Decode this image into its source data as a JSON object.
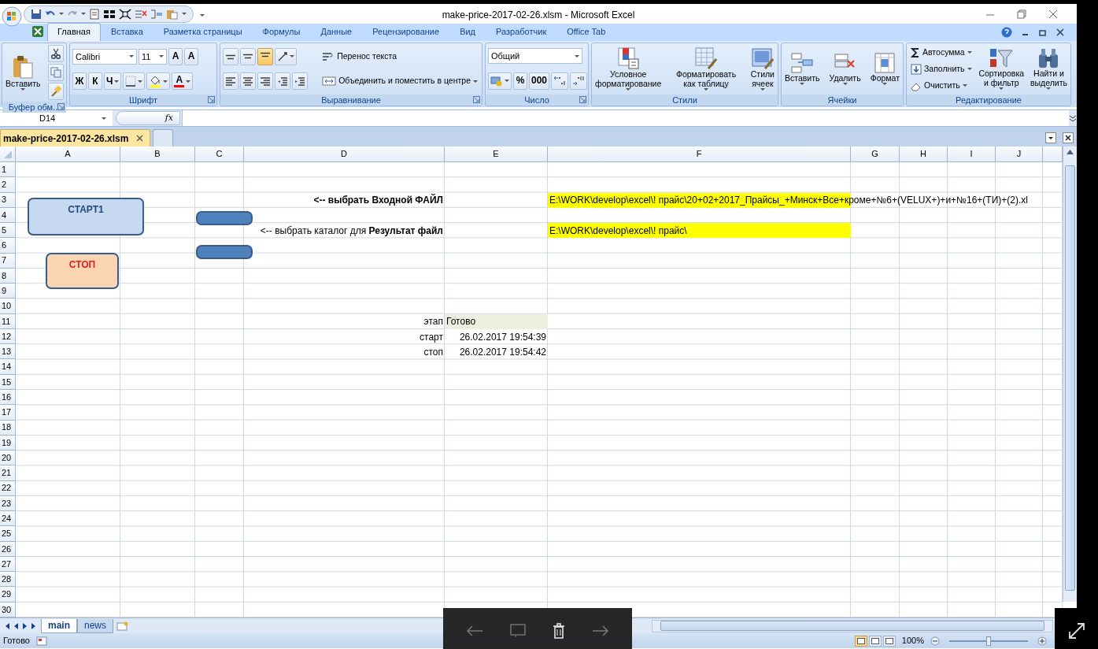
{
  "window": {
    "title": "make-price-2017-02-26.xlsm - Microsoft Excel"
  },
  "ribbon_tabs": [
    {
      "label": "Главная",
      "selected": true
    },
    {
      "label": "Вставка",
      "selected": false
    },
    {
      "label": "Разметка страницы",
      "selected": false
    },
    {
      "label": "Формулы",
      "selected": false
    },
    {
      "label": "Данные",
      "selected": false
    },
    {
      "label": "Рецензирование",
      "selected": false
    },
    {
      "label": "Вид",
      "selected": false
    },
    {
      "label": "Разработчик",
      "selected": false
    },
    {
      "label": "Office Tab",
      "selected": false
    }
  ],
  "ribbon_groups": [
    {
      "label": "Буфер обм...",
      "launcher": true,
      "columns": [
        [
          {
            "kind": "large",
            "label": "Вставить",
            "dropdown": true
          }
        ],
        [
          {
            "kind": "icon",
            "dropdown": false
          },
          {
            "kind": "icon",
            "dropdown": false
          },
          {
            "kind": "icon",
            "dropdown": false
          }
        ]
      ]
    },
    {
      "label": "Шрифт",
      "launcher": true,
      "columns": [
        [
          {
            "kind": "row",
            "items": [
              {
                "kind": "combo",
                "value": "Calibri",
                "dropdown": true
              },
              {
                "kind": "combo",
                "value": "11",
                "dropdown": true
              },
              {
                "kind": "letter",
                "label": "A",
                "dropdown": false
              },
              {
                "kind": "letter",
                "label": "A",
                "dropdown": false
              }
            ]
          },
          {
            "kind": "row",
            "items": [
              {
                "kind": "letter",
                "label": "Ж",
                "dropdown": false
              },
              {
                "kind": "letter",
                "label": "К",
                "dropdown": false
              },
              {
                "kind": "letter",
                "label": "Ч",
                "dropdown": true
              },
              {
                "kind": "icon",
                "dropdown": true
              },
              {
                "kind": "icon",
                "dropdown": true,
                "color": "#ffff00"
              },
              {
                "kind": "letter",
                "label": "A",
                "dropdown": true,
                "color": "#ff0000"
              }
            ]
          }
        ]
      ]
    },
    {
      "label": "Выравнивание",
      "launcher": true,
      "columns": [
        [
          {
            "kind": "row",
            "items": [
              {
                "kind": "icon",
                "on": false,
                "dropdown": false
              },
              {
                "kind": "icon",
                "on": false,
                "dropdown": false
              },
              {
                "kind": "icon",
                "on": true,
                "dropdown": false
              },
              {
                "kind": "icon",
                "on": false,
                "dropdown": true
              }
            ]
          },
          {
            "kind": "row",
            "items": [
              {
                "kind": "icon",
                "on": false,
                "dropdown": false
              },
              {
                "kind": "icon",
                "on": false,
                "dropdown": false
              },
              {
                "kind": "icon",
                "on": false,
                "dropdown": false
              },
              {
                "kind": "icon",
                "on": false,
                "dropdown": false
              },
              {
                "kind": "icon",
                "on": false,
                "dropdown": false
              }
            ]
          }
        ],
        [
          {
            "kind": "small",
            "label": "Перенос текста",
            "dropdown": false
          },
          {
            "kind": "small",
            "label": "Объединить и поместить в центре",
            "dropdown": true
          }
        ]
      ]
    },
    {
      "label": "Число",
      "launcher": true,
      "columns": [
        [
          {
            "kind": "combo",
            "value": "Общий",
            "dropdown": true
          },
          {
            "kind": "row",
            "items": [
              {
                "kind": "icon",
                "dropdown": true
              },
              {
                "kind": "letter",
                "label": "%",
                "dropdown": false
              },
              {
                "kind": "letter",
                "label": "000",
                "dropdown": false
              },
              {
                "kind": "icon",
                "dropdown": false
              },
              {
                "kind": "icon",
                "dropdown": false
              }
            ]
          }
        ]
      ]
    },
    {
      "label": "Стили",
      "launcher": false,
      "columns": [
        [
          {
            "kind": "large",
            "label": "Условное\nформатирование",
            "dropdown": true
          }
        ],
        [
          {
            "kind": "large",
            "label": "Форматировать\nкак таблицу",
            "dropdown": true
          }
        ],
        [
          {
            "kind": "large",
            "label": "Стили\nячеек",
            "dropdown": true
          }
        ]
      ]
    },
    {
      "label": "Ячейки",
      "launcher": false,
      "columns": [
        [
          {
            "kind": "large",
            "label": "Вставить",
            "dropdown": true
          }
        ],
        [
          {
            "kind": "large",
            "label": "Удалить",
            "dropdown": true
          }
        ],
        [
          {
            "kind": "large",
            "label": "Формат",
            "dropdown": true
          }
        ]
      ]
    },
    {
      "label": "Редактирование",
      "launcher": false,
      "columns": [
        [
          {
            "kind": "small",
            "label": "Автосумма",
            "dropdown": true
          },
          {
            "kind": "small",
            "label": "Заполнить",
            "dropdown": true
          },
          {
            "kind": "small",
            "label": "Очистить",
            "dropdown": true
          }
        ],
        [
          {
            "kind": "large",
            "label": "Сортировка\nи фильтр",
            "dropdown": true
          }
        ],
        [
          {
            "kind": "large",
            "label": "Найти и\nвыделить",
            "dropdown": true
          }
        ]
      ]
    }
  ],
  "formula_bar": {
    "name_box": "D14",
    "function_label": "fx"
  },
  "document_tabs": [
    {
      "label": "make-price-2017-02-26.xlsm",
      "selected": true
    }
  ],
  "sheet": {
    "columns": [
      "A",
      "B",
      "C",
      "D",
      "E",
      "F",
      "G",
      "H",
      "I",
      "J"
    ],
    "rows": [
      {
        "header": "1"
      },
      {
        "header": "2"
      },
      {
        "header": "3",
        "cells": [
          {},
          {},
          {},
          {
            "text": "<-- выбрать Входной ФАЙЛ",
            "right_aligned": true,
            "bold": true
          },
          {},
          {
            "text": "E:\\WORK\\develop\\excel\\! прайс\\20+02+2017_Прайсы_+Минск+Все+кроме+№6+(VELUX+)+и+№16+(ТИ)+(2).xl",
            "right_aligned": false,
            "bold": false,
            "color": "#ffff00"
          }
        ]
      },
      {
        "header": "4"
      },
      {
        "header": "5",
        "cells": [
          {},
          {},
          {},
          {
            "text": "<-- выбрать каталог для **Результат файл**",
            "right_aligned": true,
            "bold": false
          },
          {},
          {
            "text": "E:\\WORK\\develop\\excel\\! прайс\\",
            "right_aligned": false,
            "bold": false,
            "color": "#ffff00"
          }
        ]
      },
      {
        "header": "6"
      },
      {
        "header": "7"
      },
      {
        "header": "8"
      },
      {
        "header": "9"
      },
      {
        "header": "10"
      },
      {
        "header": "11",
        "cells": [
          {},
          {},
          {},
          {
            "text": "этап",
            "right_aligned": true,
            "bold": false
          },
          {
            "text": "Готово",
            "right_aligned": false,
            "bold": false,
            "color": "#ebf1de"
          }
        ]
      },
      {
        "header": "12",
        "cells": [
          {},
          {},
          {},
          {
            "text": "старт",
            "right_aligned": true,
            "bold": false
          },
          {
            "text": "26.02.2017 19:54:39",
            "right_aligned": true,
            "bold": false
          }
        ]
      },
      {
        "header": "13",
        "cells": [
          {},
          {},
          {},
          {
            "text": "стоп",
            "right_aligned": true,
            "bold": false
          },
          {
            "text": "26.02.2017 19:54:42",
            "right_aligned": true,
            "bold": false
          }
        ]
      },
      {
        "header": "14"
      },
      {
        "header": "15"
      },
      {
        "header": "16"
      },
      {
        "header": "17"
      },
      {
        "header": "18"
      },
      {
        "header": "19"
      },
      {
        "header": "20"
      },
      {
        "header": "21"
      },
      {
        "header": "22"
      },
      {
        "header": "23"
      },
      {
        "header": "24"
      },
      {
        "header": "25"
      },
      {
        "header": "26"
      },
      {
        "header": "27"
      },
      {
        "header": "28"
      },
      {
        "header": "29"
      },
      {
        "header": "30"
      }
    ],
    "shapes": [
      {
        "label": "СТАРТ1",
        "color": "#c6d9f1"
      },
      {
        "label": "СТОП",
        "color": "#fbd4b4"
      },
      {
        "color": "#4f81bd"
      },
      {
        "color": "#4f81bd"
      }
    ]
  },
  "sheet_tabs": [
    {
      "label": "main",
      "selected": true
    },
    {
      "label": "news",
      "selected": false
    }
  ],
  "status_bar": {
    "status": "Готово",
    "view_buttons": [
      {
        "selected": true
      },
      {
        "selected": false
      },
      {
        "selected": false
      }
    ],
    "zoom": "100%",
    "zoom_level": {
      "level": 0.5
    }
  }
}
